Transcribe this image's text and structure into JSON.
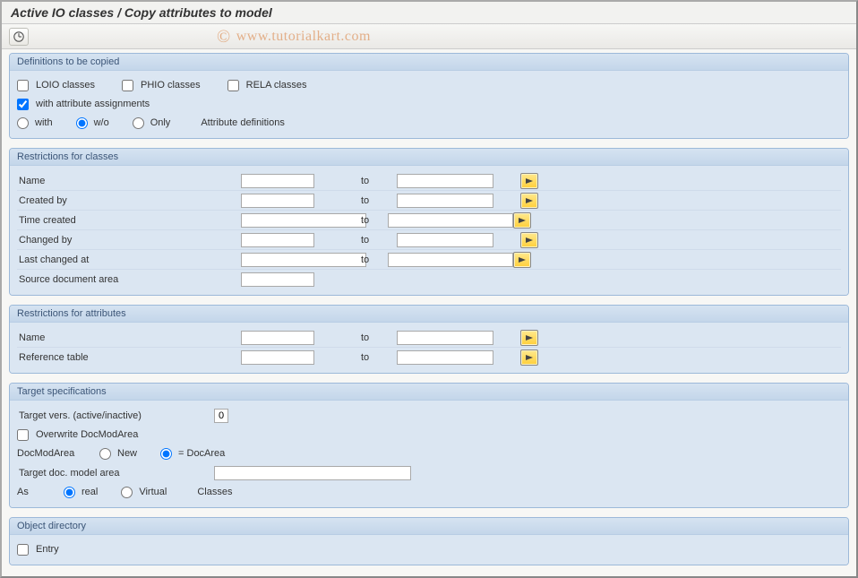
{
  "title": "Active IO classes / Copy attributes to model",
  "watermark": "www.tutorialkart.com",
  "panels": {
    "defs": {
      "title": "Definitions to be copied",
      "cb_loio": "LOIO classes",
      "cb_phio": "PHIO classes",
      "cb_rela": "RELA classes",
      "cb_withattr": "with attribute assignments",
      "rb_with": "with",
      "rb_wo": "w/o",
      "rb_only": "Only",
      "attr_def": "Attribute definitions"
    },
    "rcls": {
      "title": "Restrictions for classes",
      "rows": {
        "name": "Name",
        "createdby": "Created by",
        "timecreated": "Time created",
        "changedby": "Changed by",
        "lastchanged": "Last changed at",
        "srcdoc": "Source document area"
      },
      "to": "to"
    },
    "rattr": {
      "title": "Restrictions for attributes",
      "name": "Name",
      "reftable": "Reference table",
      "to": "to"
    },
    "target": {
      "title": "Target specifications",
      "vers": "Target vers. (active/inactive)",
      "vers_val": "0",
      "overwrite": "Overwrite DocModArea",
      "docmod_lbl": "DocModArea",
      "rb_new": "New",
      "rb_docarea": "= DocArea",
      "tgtarea": "Target doc. model area",
      "as": "As",
      "rb_real": "real",
      "rb_virtual": "Virtual",
      "classes": "Classes"
    },
    "objdir": {
      "title": "Object directory",
      "entry": "Entry"
    }
  }
}
